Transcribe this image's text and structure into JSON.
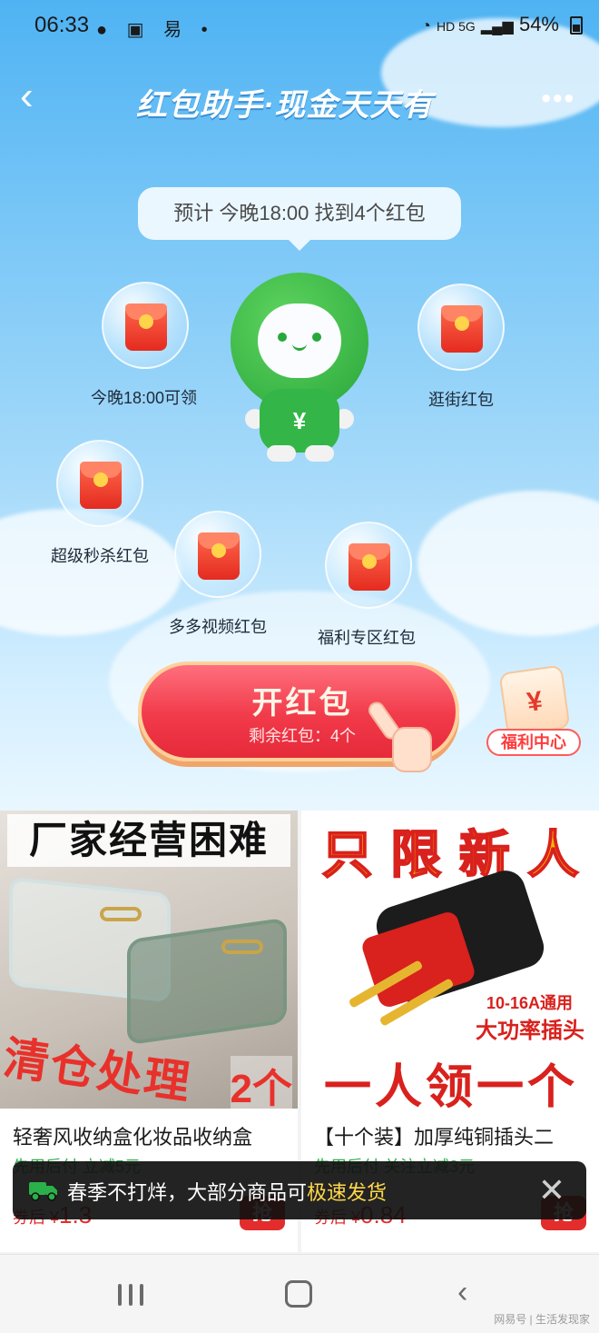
{
  "status_bar": {
    "time": "06:33",
    "left_icons": "● ▣ 易 •",
    "network": "HD 5G",
    "battery": "54%"
  },
  "nav": {
    "back_icon": "‹",
    "title": "红包助手·现金天天有",
    "more_icon": "•••"
  },
  "tip": "预计 今晚18:00 找到4个红包",
  "orbs": [
    {
      "label": "今晚18:00可领"
    },
    {
      "label": "逛街红包"
    },
    {
      "label": "超级秒杀红包"
    },
    {
      "label": "多多视频红包"
    },
    {
      "label": "福利专区红包"
    }
  ],
  "mascot": {
    "symbol": "¥"
  },
  "open_button": {
    "title": "开红包",
    "subtitle": "剩余红包：4个"
  },
  "welfare": {
    "symbol": "¥",
    "label": "福利中心"
  },
  "products": [
    {
      "banner_top": "厂家经营困难",
      "banner_bottom": "清仓处理",
      "banner_count": "2个",
      "title": "轻奢风收纳盒化妆品收纳盒",
      "promo": "先用后付  立减5元",
      "price_prefix": "券后 ¥",
      "price": "1.3",
      "grab": "抢"
    },
    {
      "banner_top": "只 限 新 人",
      "banner_spec": "10-16A通用",
      "banner_spec2": "大功率插头",
      "banner_bottom": "一人领一个",
      "title": "【十个装】加厚纯铜插头二",
      "promo": "先用后付  关注立减3元",
      "price_prefix": "券后 ¥",
      "price": "0.84",
      "grab": "抢"
    }
  ],
  "toast": {
    "text_before": "春季不打烊，大部分商品可",
    "text_highlight": "极速发货",
    "close_icon": "✕"
  },
  "system_nav": {
    "back_icon": "‹",
    "watermark": "网易号 | 生活发现家"
  },
  "colors": {
    "hero_top": "#4fb3f3",
    "accent_red": "#e32d2d",
    "promo_green": "#2bb14a",
    "mascot_green": "#28a63a"
  }
}
